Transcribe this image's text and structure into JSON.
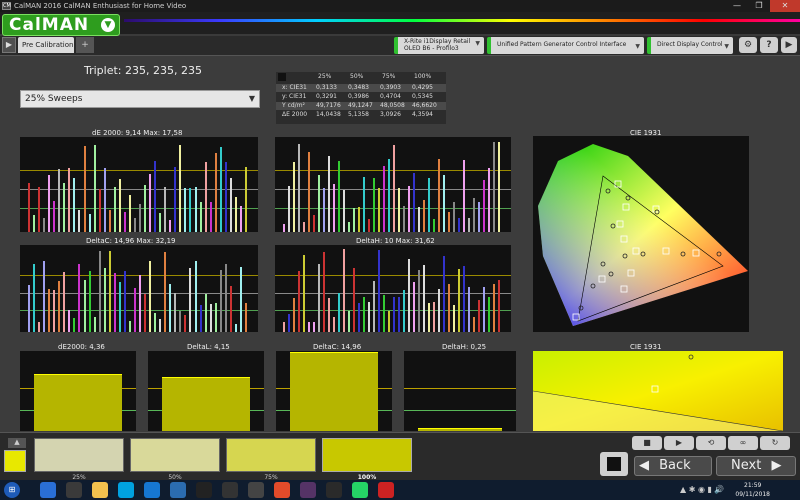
{
  "window": {
    "icon_text": "CM",
    "title": "CalMAN 2016 CalMAN Enthusiast for Home Video",
    "min": "—",
    "max": "❐",
    "close": "✕"
  },
  "brand": {
    "logo": "CalMAN",
    "logo_menu": "▼"
  },
  "toolbar": {
    "play": "▶",
    "tab_label": "Pre Calibration",
    "tab_add": "+",
    "meter": {
      "line1": "X-Rite i1Display Retail",
      "line2": "OLED B6 - Profilo3",
      "arrow": "▼"
    },
    "generator": {
      "label": "Unified Pattern Generator Control Interface",
      "arrow": "▼"
    },
    "display": {
      "label": "Direct Display Control",
      "arrow": "▼"
    },
    "settings_icon": "⚙",
    "help_icon": "?",
    "expand_icon": "▶"
  },
  "workspace": {
    "triplet": "Triplet: 235, 235, 235",
    "sweep_select": "25% Sweeps",
    "table": {
      "headers": [
        "25%",
        "50%",
        "75%",
        "100%"
      ],
      "rows": [
        {
          "label": "x: CIE31",
          "values": [
            "0,3133",
            "0,3483",
            "0,3903",
            "0,4295"
          ]
        },
        {
          "label": "y: CIE31",
          "values": [
            "0,3291",
            "0,3986",
            "0,4704",
            "0,5345"
          ]
        },
        {
          "label": "Y cd/m²",
          "values": [
            "49,7176",
            "49,1247",
            "48,0508",
            "46,6620"
          ]
        },
        {
          "label": "ΔE 2000",
          "values": [
            "14,0438",
            "5,1358",
            "3,0926",
            "4,3594"
          ]
        }
      ]
    },
    "charts": {
      "de2000": "dE 2000: 9,14  Max: 17,58",
      "deltac": "DeltaC: 14,96  Max: 32,19",
      "deltah": "DeltaH: 10  Max: 31,62",
      "cie_top": "CIE 1931",
      "cie_bottom": "CIE 1931",
      "sum_de": "dE2000: 4,36",
      "sum_dl": "DeltaL: 4,15",
      "sum_dc": "DeltaC: 14,96",
      "sum_dh": "DeltaH: 0,25"
    }
  },
  "bottom": {
    "steps": [
      {
        "label": "25%",
        "color": "#d4d4b0"
      },
      {
        "label": "50%",
        "color": "#d9d99a"
      },
      {
        "label": "75%",
        "color": "#d6d650"
      },
      {
        "label": "100%",
        "color": "#c8c800"
      }
    ],
    "back": "Back",
    "next": "Next"
  },
  "taskbar": {
    "time": "21:59",
    "date": "09/11/2018",
    "colors": [
      "#2a6fd6",
      "#3a3a3a",
      "#f2c14e",
      "#00a1e0",
      "#1677d2",
      "#2b6cb0",
      "#222",
      "#333",
      "#444",
      "#e34b2a",
      "#553366",
      "#2a2a2a",
      "#25d366",
      "#cc2222"
    ]
  }
}
